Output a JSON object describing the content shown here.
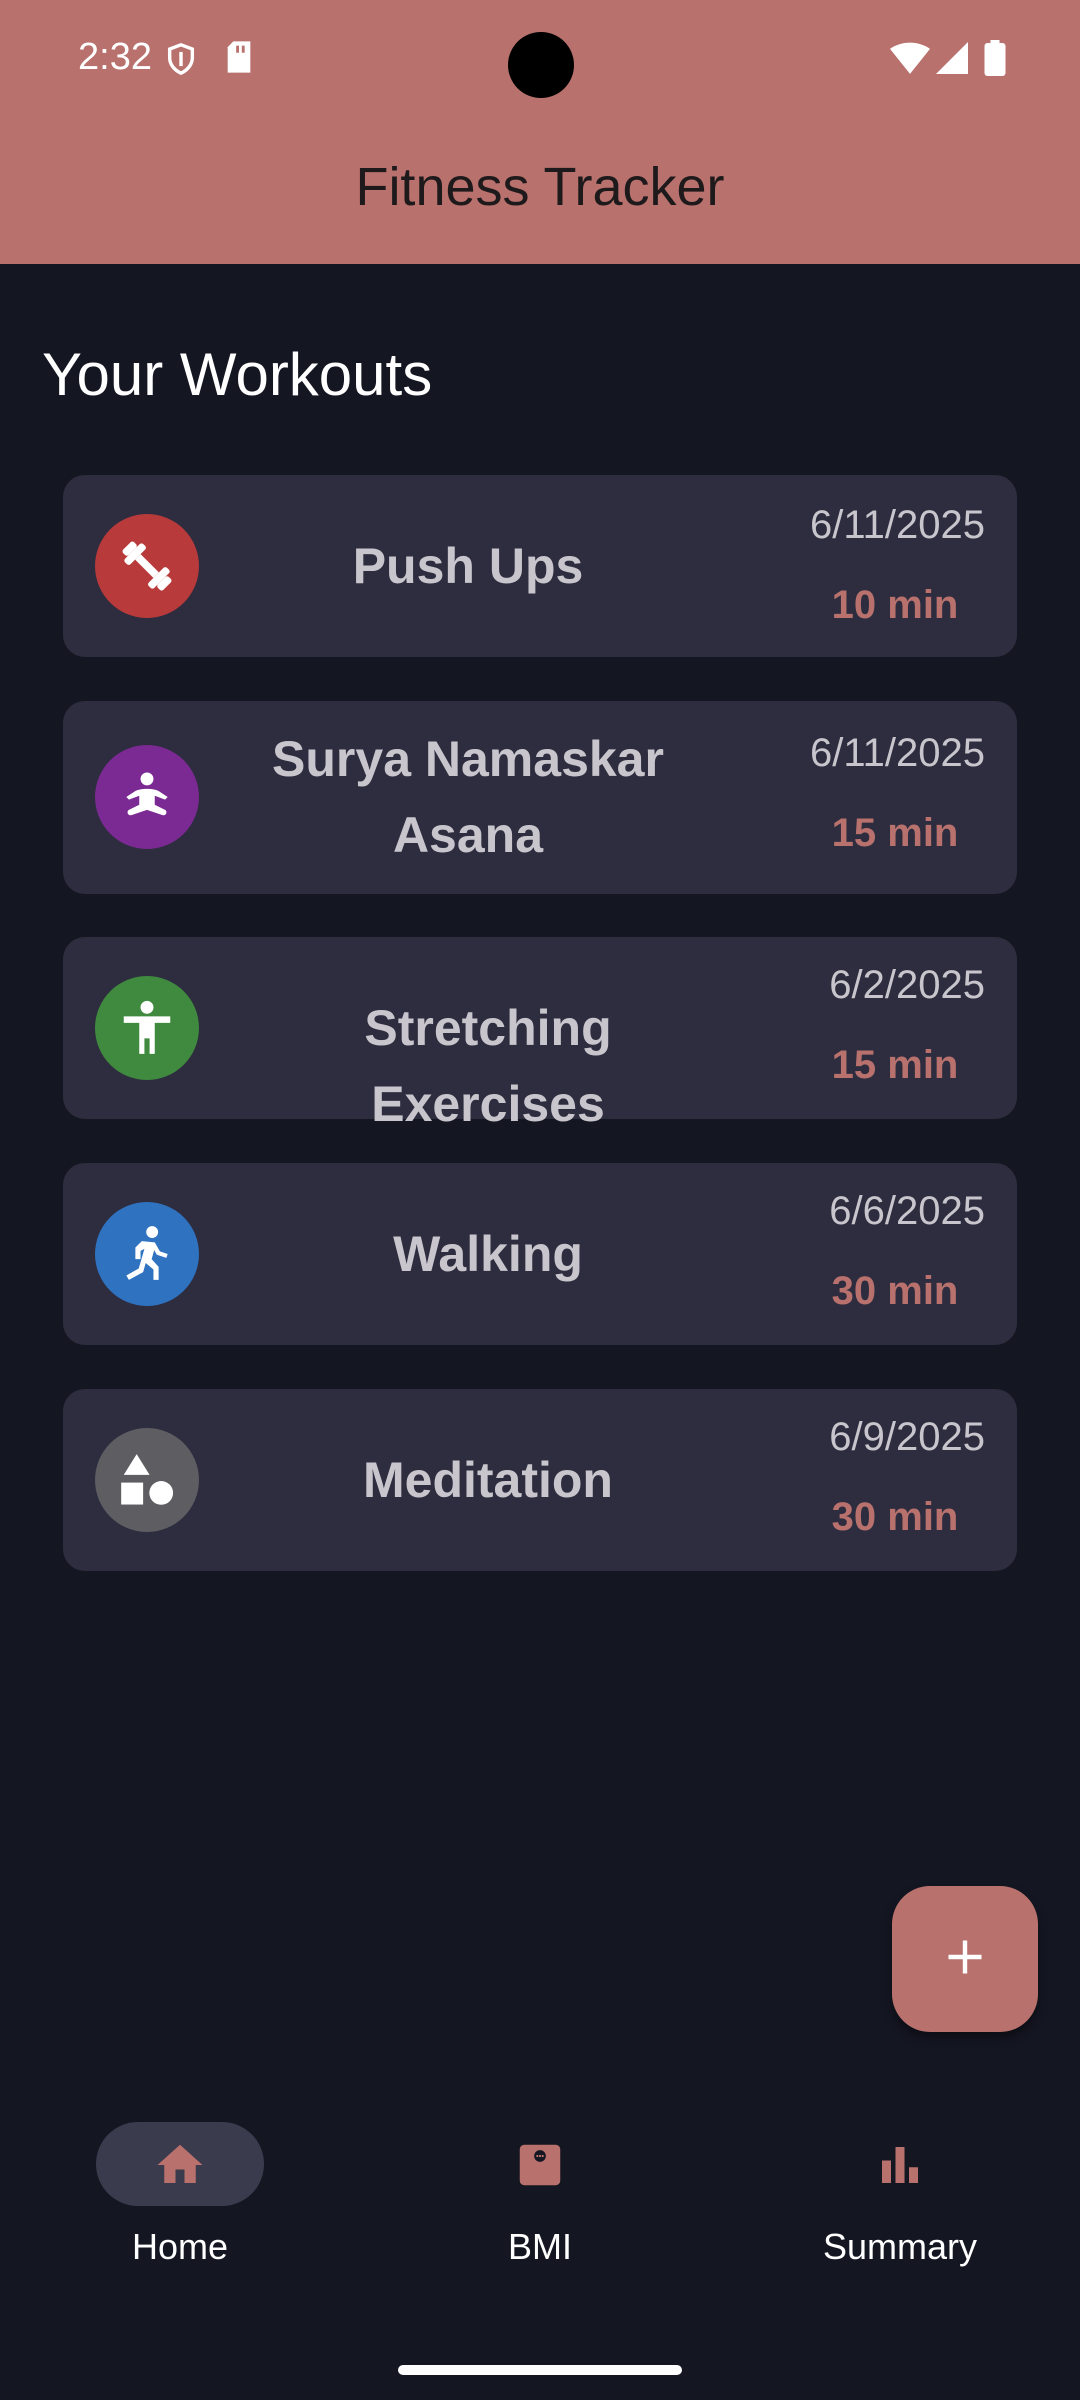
{
  "status_bar": {
    "time": "2:32",
    "icons": [
      "shield-icon",
      "sd-card-icon",
      "wifi-icon",
      "cellular-icon",
      "battery-icon"
    ]
  },
  "app_bar": {
    "title": "Fitness Tracker"
  },
  "section_title": "Your Workouts",
  "workouts": [
    {
      "name": "Push Ups",
      "date": "6/11/2025",
      "duration": "10 min",
      "icon": "dumbbell-icon",
      "color": "#b83a3a"
    },
    {
      "name": "Surya Namaskar Asana",
      "date": "6/11/2025",
      "duration": "15 min",
      "icon": "yoga-icon",
      "color": "#7a2a92"
    },
    {
      "name": "Stretching Exercises",
      "date": "6/2/2025",
      "duration": "15 min",
      "icon": "stretch-icon",
      "color": "#3f8a3f"
    },
    {
      "name": "Walking",
      "date": "6/6/2025",
      "duration": "30 min",
      "icon": "walking-icon",
      "color": "#2f72c0"
    },
    {
      "name": "Meditation",
      "date": "6/9/2025",
      "duration": "30 min",
      "icon": "shapes-icon",
      "color": "#5d5d62"
    }
  ],
  "fab": {
    "icon": "plus-icon"
  },
  "nav": {
    "items": [
      {
        "label": "Home",
        "icon": "home-icon",
        "selected": true
      },
      {
        "label": "BMI",
        "icon": "scale-icon",
        "selected": false
      },
      {
        "label": "Summary",
        "icon": "bar-chart-icon",
        "selected": false
      }
    ]
  },
  "colors": {
    "accent": "#b8716c",
    "background": "#141622",
    "card": "#2e2d3f"
  }
}
